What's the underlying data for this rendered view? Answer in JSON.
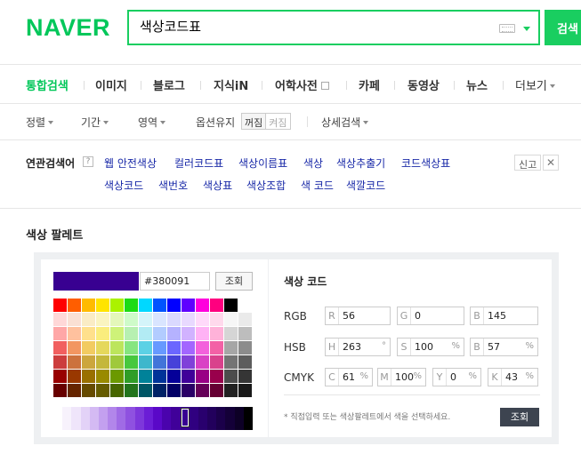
{
  "header": {
    "logo": "NAVER",
    "search_value": "색상코드표",
    "search_button": "검색"
  },
  "tabs": [
    {
      "label": "통합검색",
      "active": true
    },
    {
      "label": "이미지"
    },
    {
      "label": "블로그"
    },
    {
      "label": "지식iN"
    },
    {
      "label": "어학사전"
    },
    {
      "label": "카페"
    },
    {
      "label": "동영상"
    },
    {
      "label": "뉴스"
    },
    {
      "label": "더보기"
    }
  ],
  "options": {
    "sort": "정렬",
    "period": "기간",
    "area": "영역",
    "keep_option": "옵션유지",
    "toggle_on": "꺼짐",
    "toggle_off": "켜짐",
    "detail_search": "상세검색"
  },
  "related": {
    "title": "연관검색어",
    "help": "?",
    "report": "신고",
    "close": "✕",
    "keywords": [
      "웹 안전색상",
      "컬러코드표",
      "색상이름표",
      "색상",
      "색상추출기",
      "코드색상표",
      "색상코드",
      "색번호",
      "색상표",
      "색상조합",
      "색 코드",
      "색깔코드"
    ]
  },
  "palette": {
    "title": "색상 팔레트",
    "selected_color": "#380091",
    "hex_value": "#380091",
    "lookup_button": "조회",
    "code_title": "색상 코드",
    "rgb": {
      "label": "RGB",
      "r": "56",
      "g": "0",
      "b": "145"
    },
    "hsb": {
      "label": "HSB",
      "h": "263",
      "s": "100",
      "b": "57",
      "deg": "°",
      "pct": "%"
    },
    "cmyk": {
      "label": "CMYK",
      "c": "61",
      "m": "100",
      "y": "0",
      "k": "43",
      "pct": "%"
    },
    "note": "* 직접입력 또는 색상팔레트에서 색을 선택하세요.",
    "view_button": "조회",
    "grid_rows": [
      [
        "#ff0000",
        "#ff5e00",
        "#ffbb00",
        "#ffe400",
        "#abf200",
        "#1ddb16",
        "#00d8ff",
        "#0054ff",
        "#0100ff",
        "#5f00ff",
        "#ff00dd",
        "#ff007f",
        "#000000",
        "#ffffff"
      ],
      [
        "#ffd8d8",
        "#fae0d4",
        "#faecc5",
        "#faf4c0",
        "#e4f7ba",
        "#cefbc9",
        "#d4f4fa",
        "#d9e5ff",
        "#dad9ff",
        "#e8d9ff",
        "#ffd9fa",
        "#ffd9ec",
        "#f6f6f6",
        "#eaeaea"
      ],
      [
        "#ffa7a7",
        "#ffc19e",
        "#ffe08c",
        "#faed7d",
        "#cef279",
        "#b7f0b1",
        "#b2ebf4",
        "#b2ccff",
        "#b5b2ff",
        "#d1b2ff",
        "#ffb2f5",
        "#ffb2d9",
        "#d5d5d5",
        "#bdbdbd"
      ],
      [
        "#f15f5f",
        "#f29661",
        "#f2cb61",
        "#e5d85c",
        "#bce55c",
        "#86e57f",
        "#5cd1e5",
        "#6799ff",
        "#6b66ff",
        "#a366ff",
        "#f361dc",
        "#f361a6",
        "#a6a6a6",
        "#8c8c8c"
      ],
      [
        "#cc3d3d",
        "#cc723d",
        "#cca63d",
        "#c4b73b",
        "#9fc93c",
        "#47c83e",
        "#3db7cc",
        "#4374d9",
        "#4641d9",
        "#8041d9",
        "#d941c5",
        "#d9418c",
        "#747474",
        "#5d5d5d"
      ],
      [
        "#980000",
        "#993800",
        "#997000",
        "#998a00",
        "#6b9900",
        "#2f9d27",
        "#008299",
        "#003399",
        "#050099",
        "#3f0099",
        "#990085",
        "#99004c",
        "#4c4c4c",
        "#353535"
      ],
      [
        "#670000",
        "#662500",
        "#664b00",
        "#665c00",
        "#476600",
        "#22741c",
        "#005766",
        "#002266",
        "#020066",
        "#2a0066",
        "#660058",
        "#660033",
        "#212121",
        "#191919"
      ]
    ],
    "strip": [
      "#ffffff",
      "#f7f2fc",
      "#efe5fa",
      "#e3d2f7",
      "#d4baf3",
      "#c3a0ef",
      "#b286ea",
      "#a06be5",
      "#8f51e0",
      "#7d37db",
      "#6b1dd6",
      "#5a08c8",
      "#4a03ad",
      "#400199",
      "#380091",
      "#300080",
      "#29006e",
      "#22005c",
      "#1b004a",
      "#140038",
      "#0d0026",
      "#000000"
    ]
  }
}
